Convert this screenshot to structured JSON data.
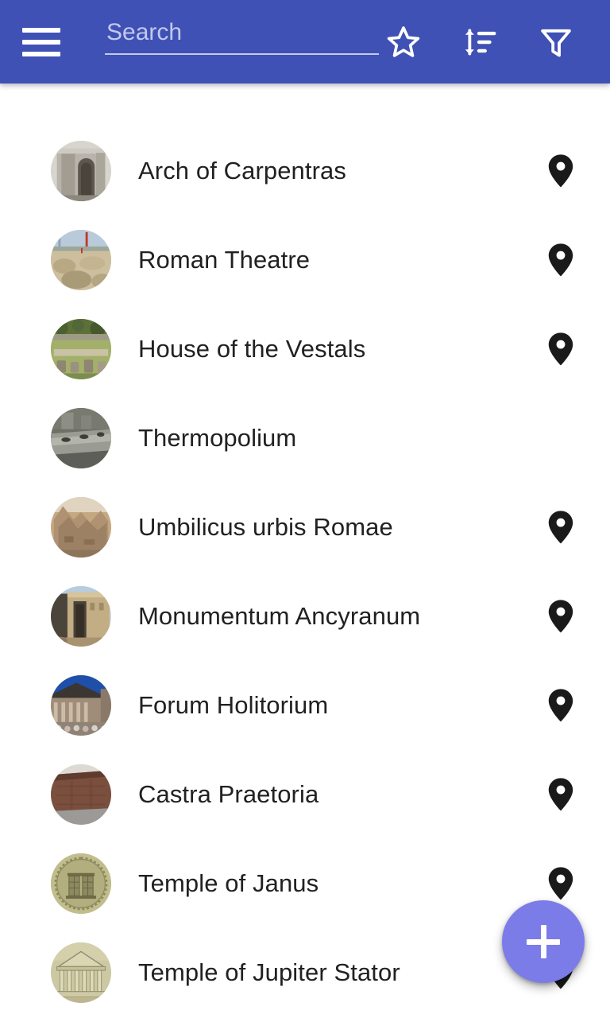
{
  "appbar": {
    "background_color": "#3f51b5",
    "menu_icon": "hamburger-menu-icon",
    "search": {
      "placeholder": "Search",
      "value": ""
    },
    "actions": [
      {
        "name": "favorites",
        "icon": "star-outline-icon",
        "label": "Favorites"
      },
      {
        "name": "sort",
        "icon": "sort-icon",
        "label": "Sort"
      },
      {
        "name": "filter",
        "icon": "filter-funnel-icon",
        "label": "Filter"
      }
    ]
  },
  "list": {
    "items": [
      {
        "label": "Arch of Carpentras",
        "thumb": "stone-arch-photo",
        "has_pin": true,
        "pin_icon": "map-pin-icon"
      },
      {
        "label": "Roman Theatre",
        "thumb": "theatre-ruins-photo",
        "has_pin": true,
        "pin_icon": "map-pin-icon"
      },
      {
        "label": "House of the Vestals",
        "thumb": "green-ruins-photo",
        "has_pin": true,
        "pin_icon": "map-pin-icon"
      },
      {
        "label": "Thermopolium",
        "thumb": "stone-counter-photo",
        "has_pin": false,
        "pin_icon": "map-pin-icon"
      },
      {
        "label": "Umbilicus urbis Romae",
        "thumb": "brick-ruin-photo",
        "has_pin": true,
        "pin_icon": "map-pin-icon"
      },
      {
        "label": "Monumentum Ancyranum",
        "thumb": "stone-temple-photo",
        "has_pin": true,
        "pin_icon": "map-pin-icon"
      },
      {
        "label": "Forum Holitorium",
        "thumb": "church-columns-photo",
        "has_pin": true,
        "pin_icon": "map-pin-icon"
      },
      {
        "label": "Castra Praetoria",
        "thumb": "brick-wall-photo",
        "has_pin": true,
        "pin_icon": "map-pin-icon"
      },
      {
        "label": "Temple of Janus",
        "thumb": "roman-coin-janus-photo",
        "has_pin": true,
        "pin_icon": "map-pin-icon"
      },
      {
        "label": "Temple of Jupiter Stator",
        "thumb": "temple-engraving-photo",
        "has_pin": true,
        "pin_icon": "map-pin-icon"
      }
    ]
  },
  "fab": {
    "icon": "plus-icon",
    "label": "Add",
    "color": "#7b7ce8"
  },
  "colors": {
    "appbar": "#3f51b5",
    "accent": "#7b7ce8",
    "text_primary": "#212121",
    "placeholder": "#c2c8ec",
    "pin": "#1a1a1a",
    "background": "#ffffff"
  }
}
